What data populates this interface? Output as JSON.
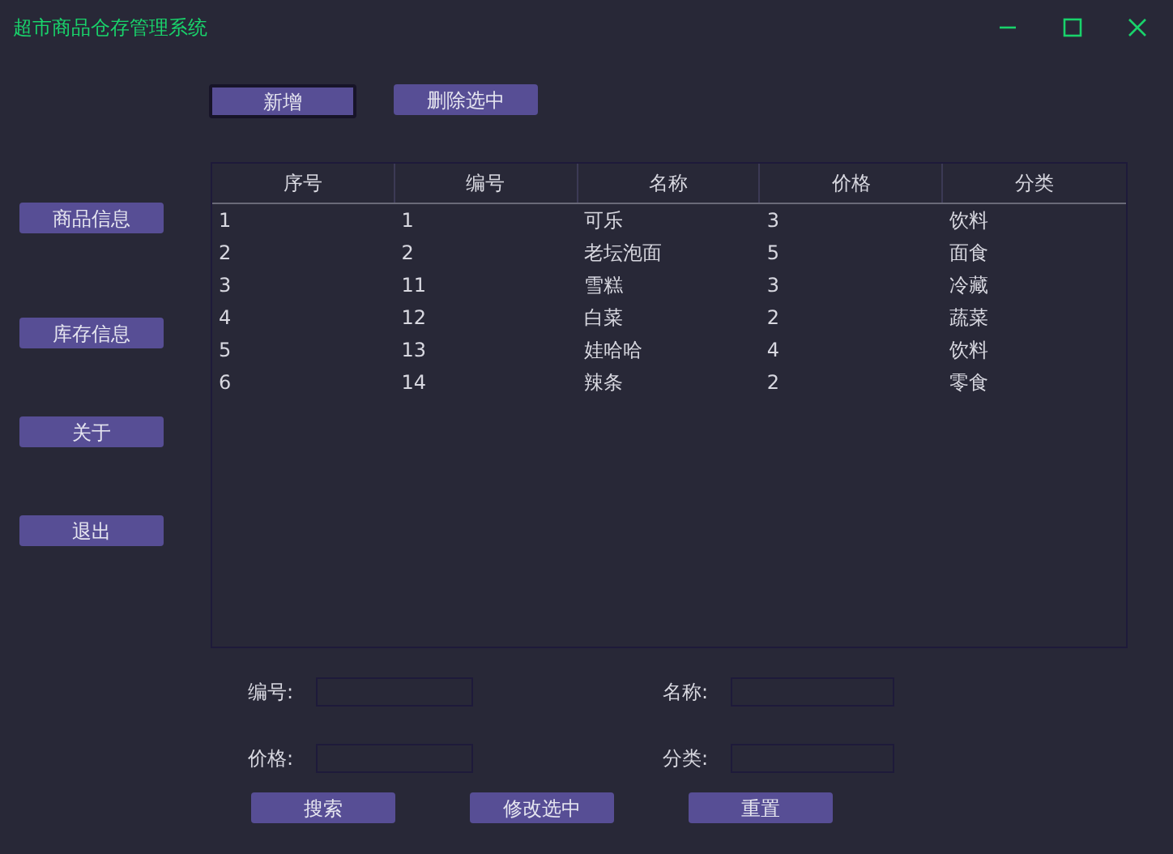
{
  "window": {
    "title": "超市商品仓存管理系统"
  },
  "toolbar": [
    {
      "label": "新增",
      "focused": true
    },
    {
      "label": "删除选中",
      "focused": false
    }
  ],
  "sidebar": {
    "items": [
      "商品信息",
      "库存信息",
      "关于",
      "退出"
    ]
  },
  "table": {
    "columns": [
      "序号",
      "编号",
      "名称",
      "价格",
      "分类"
    ],
    "rows": [
      [
        "1",
        "1",
        "可乐",
        "3",
        "饮料"
      ],
      [
        "2",
        "2",
        "老坛泡面",
        "5",
        "面食"
      ],
      [
        "3",
        "11",
        "雪糕",
        "3",
        "冷藏"
      ],
      [
        "4",
        "12",
        "白菜",
        "2",
        "蔬菜"
      ],
      [
        "5",
        "13",
        "娃哈哈",
        "4",
        "饮料"
      ],
      [
        "6",
        "14",
        "辣条",
        "2",
        "零食"
      ]
    ]
  },
  "form": {
    "fields": [
      {
        "label": "编号:"
      },
      {
        "label": "名称:"
      },
      {
        "label": "价格:"
      },
      {
        "label": "分类:"
      }
    ],
    "buttons": [
      "搜索",
      "修改选中",
      "重置"
    ]
  }
}
